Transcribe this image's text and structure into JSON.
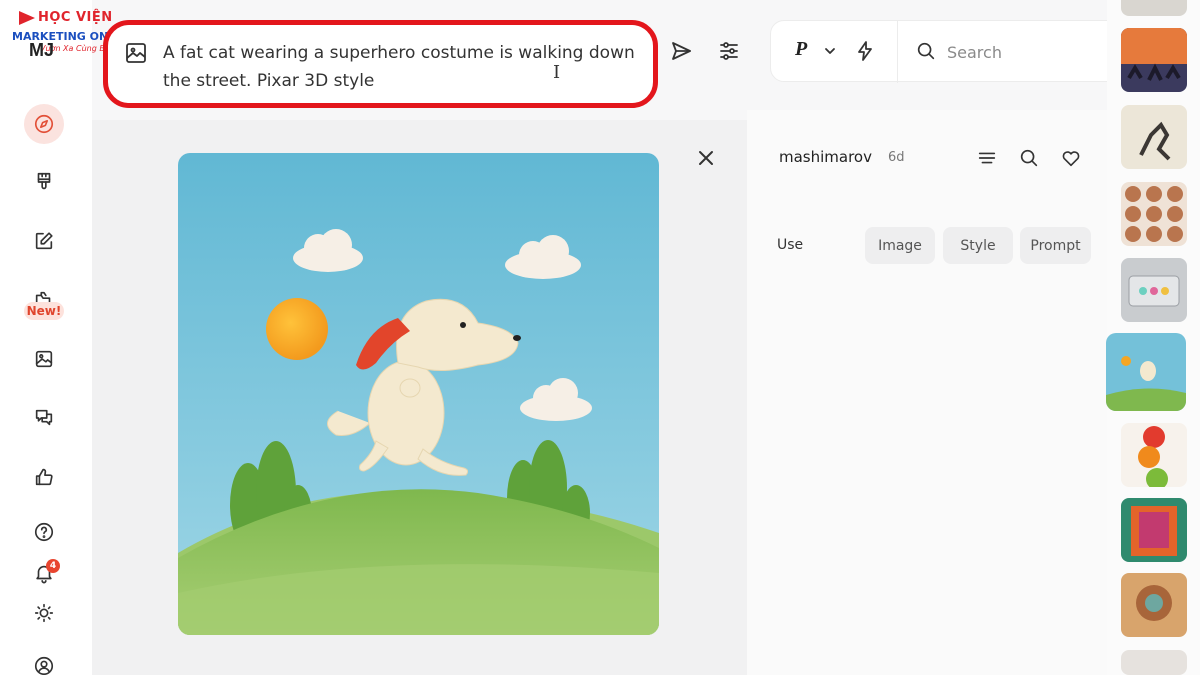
{
  "watermark": {
    "brand_top": "HỌC VIỆN",
    "brand_main": "MARKETING ONLINE",
    "tagline": "Vươn Xa Cùng Bạn"
  },
  "app": {
    "logo_text": "MJ"
  },
  "sidebar": {
    "items": [
      {
        "name": "explore",
        "icon": "compass-icon",
        "active": true
      },
      {
        "name": "create",
        "icon": "paintbrush-icon"
      },
      {
        "name": "edit",
        "icon": "pencil-square-icon"
      },
      {
        "name": "personalize",
        "icon": "folder-icon",
        "badge": "New!"
      },
      {
        "name": "organize",
        "icon": "image-icon"
      },
      {
        "name": "chat",
        "icon": "chat-bubbles-icon"
      },
      {
        "name": "rank",
        "icon": "thumbs-up-icon"
      },
      {
        "name": "help",
        "icon": "help-circle-icon"
      },
      {
        "name": "notifications",
        "icon": "bell-icon",
        "badge": "4"
      },
      {
        "name": "theme",
        "icon": "sun-icon"
      },
      {
        "name": "profile",
        "icon": "user-circle-icon"
      }
    ]
  },
  "prompt": {
    "text": "A fat cat wearing a superhero costume is walking down the street. Pixar 3D style",
    "cursor": "I"
  },
  "toolbar": {
    "mode_label": "P"
  },
  "search": {
    "placeholder": "Search"
  },
  "detail": {
    "author": "mashimarov",
    "age": "6d",
    "use_label": "Use",
    "use_buttons": [
      "Image",
      "Style",
      "Prompt"
    ]
  },
  "colors": {
    "accent": "#e25038",
    "highlight_border": "#e3161c",
    "sky": "#69bcd6",
    "grass": "#7fb84e"
  }
}
